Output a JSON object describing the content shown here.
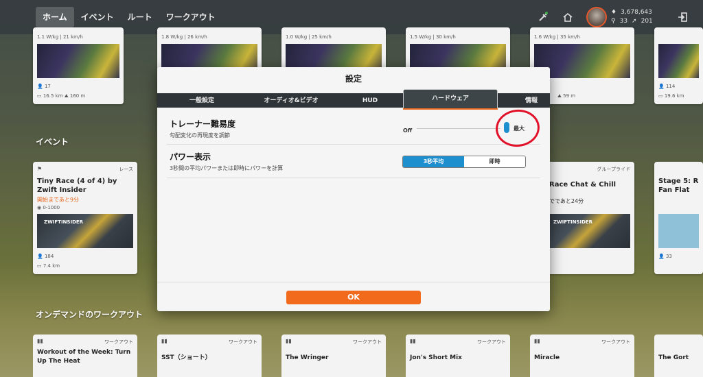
{
  "nav": {
    "tabs": [
      "ホーム",
      "イベント",
      "ルート",
      "ワークアウト"
    ],
    "stats": {
      "drops": "3,678,643",
      "followers": "33",
      "following": "201"
    }
  },
  "home": {
    "top_cards": [
      {
        "wkg": "1.1 W/kg",
        "speed": "21 km/h",
        "riders": "17",
        "distance": "16.5 km",
        "elevation": "160 m"
      },
      {
        "wkg": "1.8 W/kg",
        "speed": "26 km/h"
      },
      {
        "wkg": "1.0 W/kg",
        "speed": "25 km/h"
      },
      {
        "wkg": "1.5 W/kg",
        "speed": "30 km/h"
      },
      {
        "wkg": "1.6 W/kg",
        "speed": "35 km/h",
        "distance": "59 m"
      },
      {
        "riders": "114",
        "distance": "19.6 km"
      }
    ],
    "events_title": "イベント",
    "events": [
      {
        "tag": "レース",
        "title": "Tiny Race (4 of 4) by Zwift Insider",
        "starts": "開始まであと9分",
        "category": "0-1000",
        "riders": "184",
        "distance": "7.4 km",
        "brand": "ZWIFTINSIDER"
      },
      {
        "tag": "グループライド",
        "title": "Race Chat & Chill",
        "starts": "でであと24分",
        "brand": "ZWIFTINSIDER"
      },
      {
        "title": "Stage 5: R Fan Flat",
        "riders": "33"
      }
    ],
    "workouts_title": "オンデマンドのワークアウト",
    "workouts": [
      {
        "label": "ワークアウト",
        "title": "Workout of the Week: Turn Up The Heat"
      },
      {
        "label": "ワークアウト",
        "title": "SST（ショート）"
      },
      {
        "label": "ワークアウト",
        "title": "The Wringer"
      },
      {
        "label": "ワークアウト",
        "title": "Jon's Short Mix"
      },
      {
        "label": "ワークアウト",
        "title": "Miracle"
      },
      {
        "label": "",
        "title": "The Gort"
      }
    ]
  },
  "modal": {
    "title": "設定",
    "tabs": [
      "一般設定",
      "オーディオ&ビデオ",
      "HUD",
      "ハードウェア",
      "情報"
    ],
    "active_tab": "ハードウェア",
    "trainer": {
      "title": "トレーナー難易度",
      "desc": "勾配変化の再現度を調節",
      "min_label": "Off",
      "max_label": "最大",
      "value": 1.0
    },
    "power": {
      "title": "パワー表示",
      "desc": "3秒間の平均パワーまたは即時にパワーを計算",
      "options": [
        "3秒平均",
        "即時"
      ],
      "selected": "3秒平均"
    },
    "ok_label": "OK"
  },
  "colors": {
    "accent": "#f26b1d",
    "selected": "#1d8fcf",
    "annotation": "#e2112a"
  }
}
